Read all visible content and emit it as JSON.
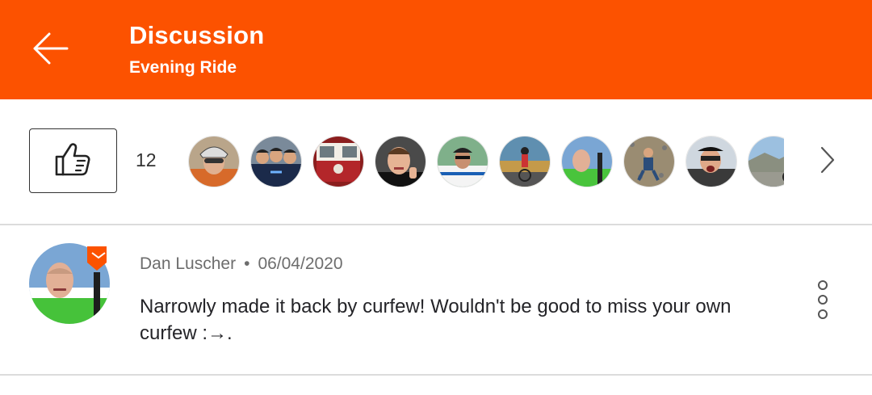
{
  "header": {
    "title": "Discussion",
    "subtitle": "Evening Ride",
    "back_icon": "arrow-left-icon",
    "background": "#fc5200"
  },
  "kudos": {
    "button_icon": "thumbs-up-icon",
    "count": "12",
    "avatars": [
      "helmeted-cyclist-avatar",
      "team-sky-group-avatar",
      "vw-van-avatar",
      "thumbs-up-man-avatar",
      "cyclist-jersey-avatar",
      "road-cyclist-avatar",
      "green-shirt-avatar",
      "rider-on-gravel-avatar",
      "shouting-man-avatar",
      "mountain-cyclist-avatar"
    ],
    "next_icon": "chevron-right-icon"
  },
  "comment": {
    "author": "Dan Luscher",
    "separator": "•",
    "date": "06/04/2020",
    "text": "Narrowly made it back by curfew! Wouldn't be good to miss your own curfew :→.",
    "more_icon": "more-vertical-icon"
  }
}
